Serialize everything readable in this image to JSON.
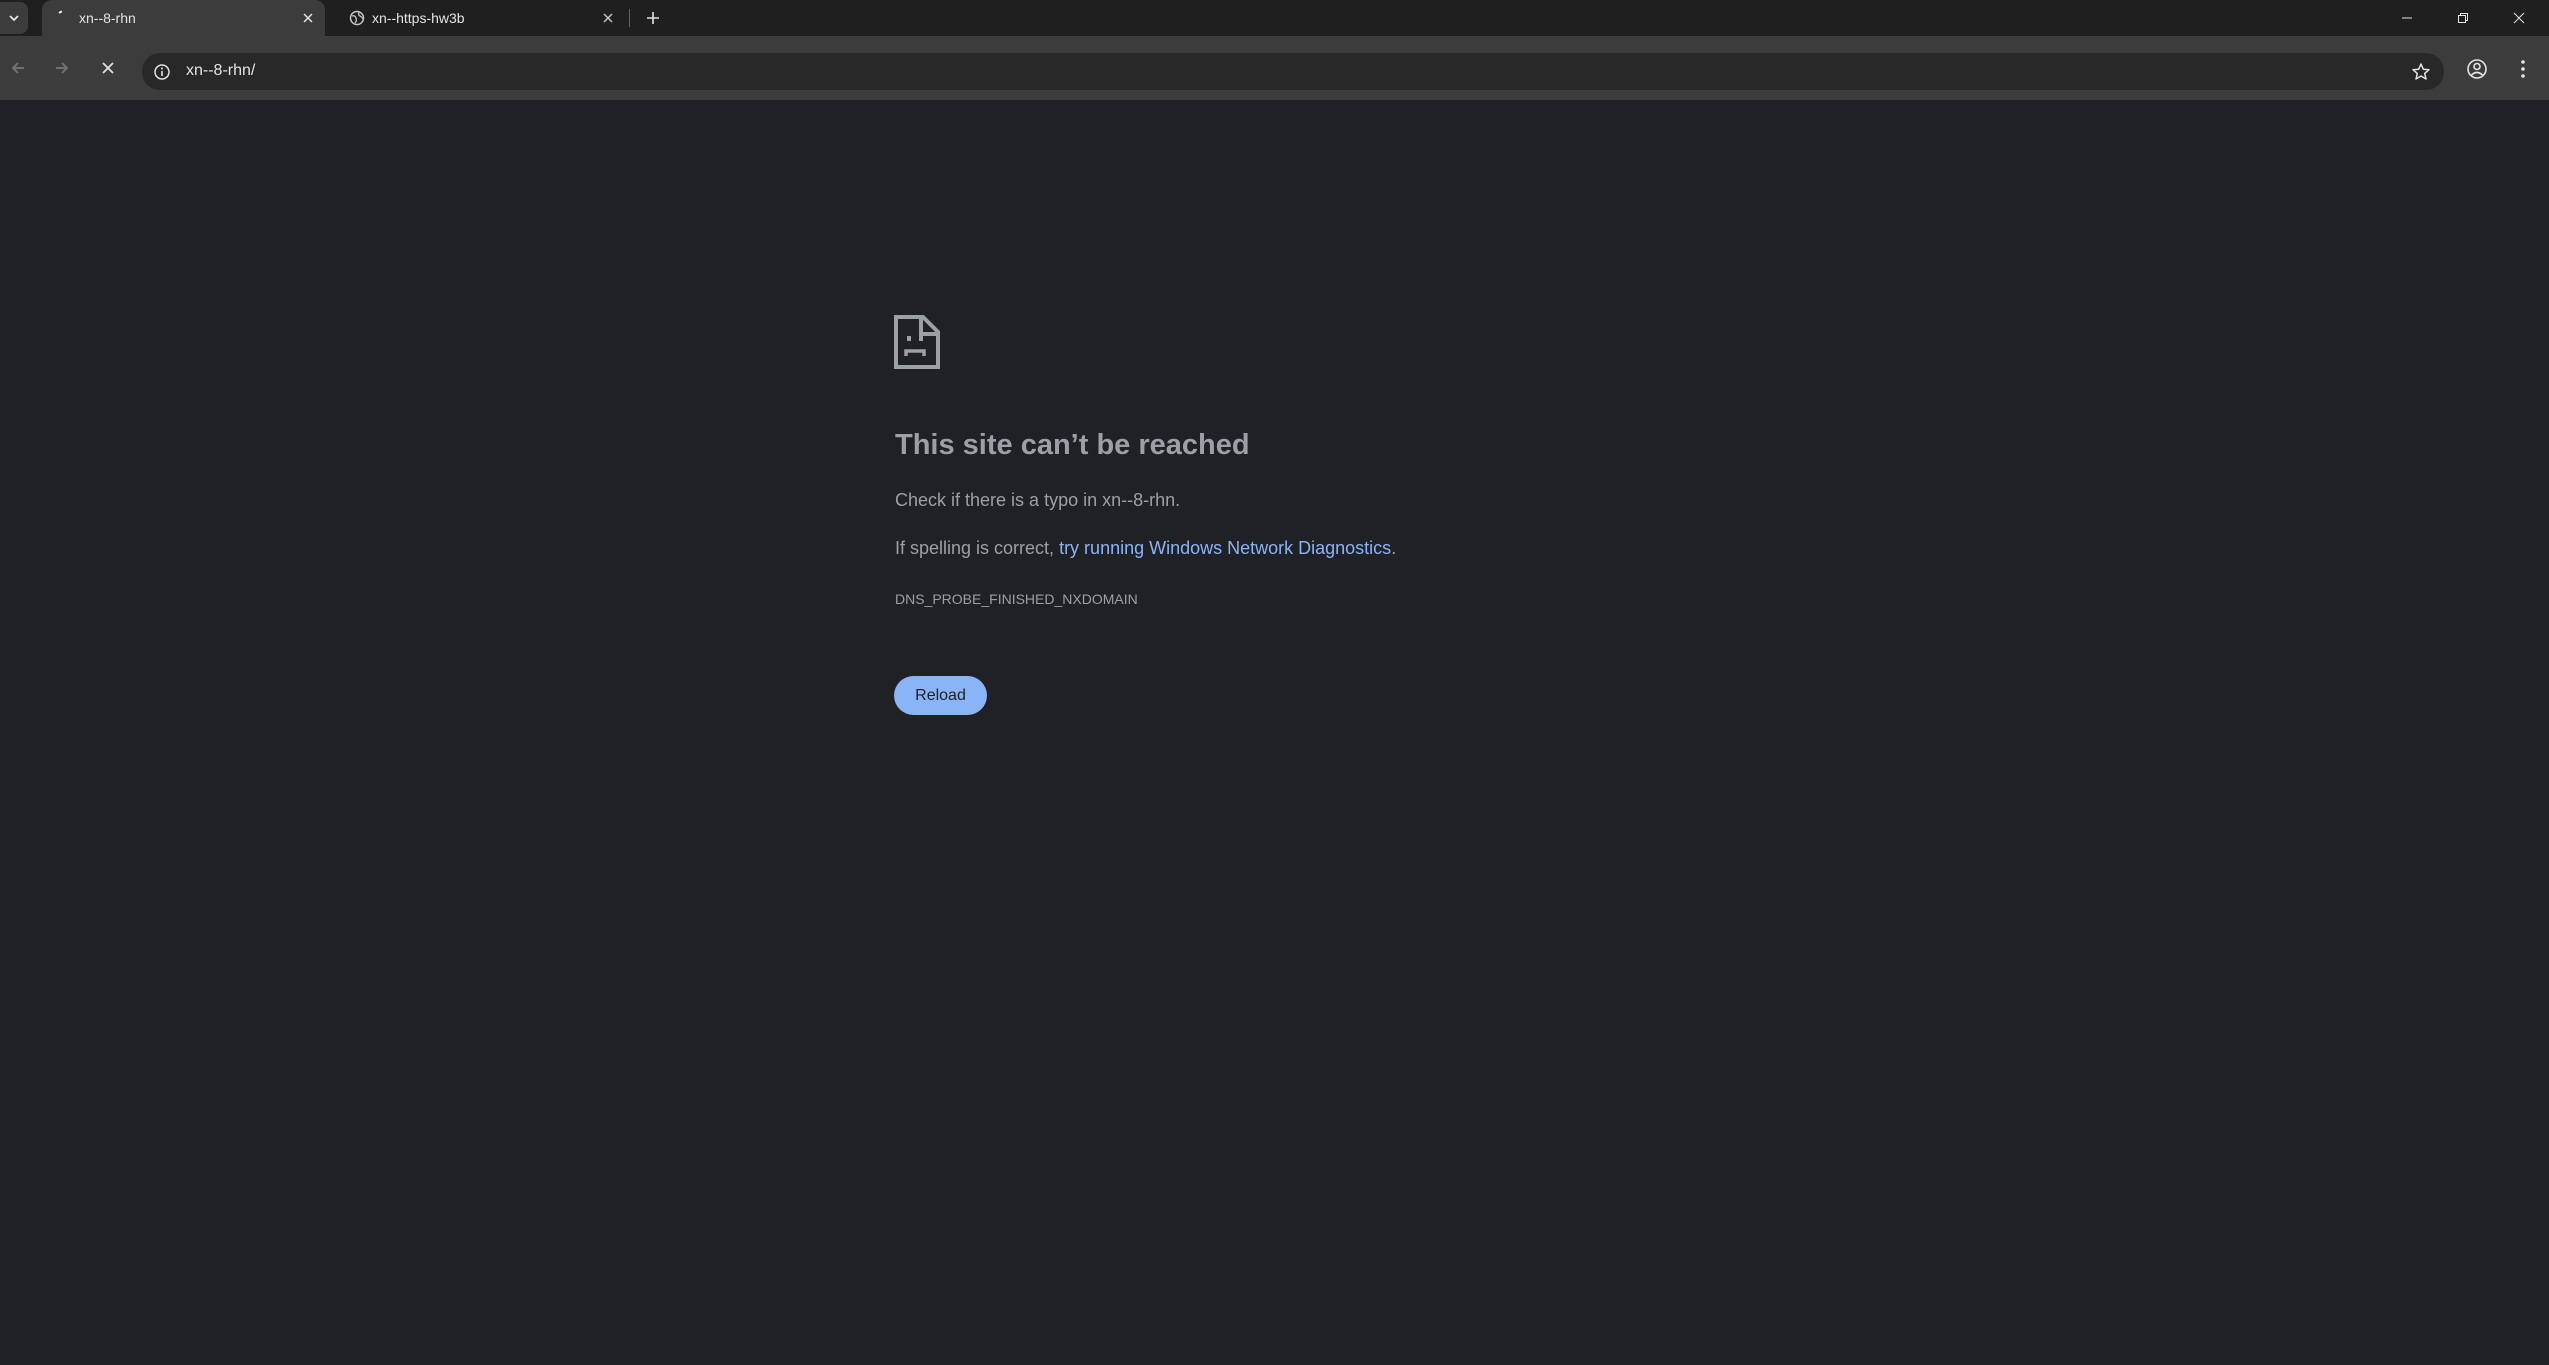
{
  "tabs": [
    {
      "title": "xn--8-rhn",
      "favicon": "loading-spinner-icon",
      "active": true
    },
    {
      "title": "xn--https-hw3b",
      "favicon": "globe-icon",
      "active": false
    }
  ],
  "address_bar": {
    "url": "xn--8-rhn/"
  },
  "error_page": {
    "title": "This site can’t be reached",
    "typo_line": "Check if there is a typo in xn--8-rhn.",
    "spelling_prefix": "If spelling is correct, ",
    "diagnostics_link": "try running Windows Network Diagnostics",
    "spelling_suffix": ".",
    "error_code": "DNS_PROBE_FINISHED_NXDOMAIN",
    "reload_label": "Reload"
  },
  "colors": {
    "page_background": "#202124",
    "toolbar": "#3c3c3c",
    "link": "#8ab4f8",
    "button": "#8ab4f8",
    "muted_text": "#9aa0a6"
  }
}
